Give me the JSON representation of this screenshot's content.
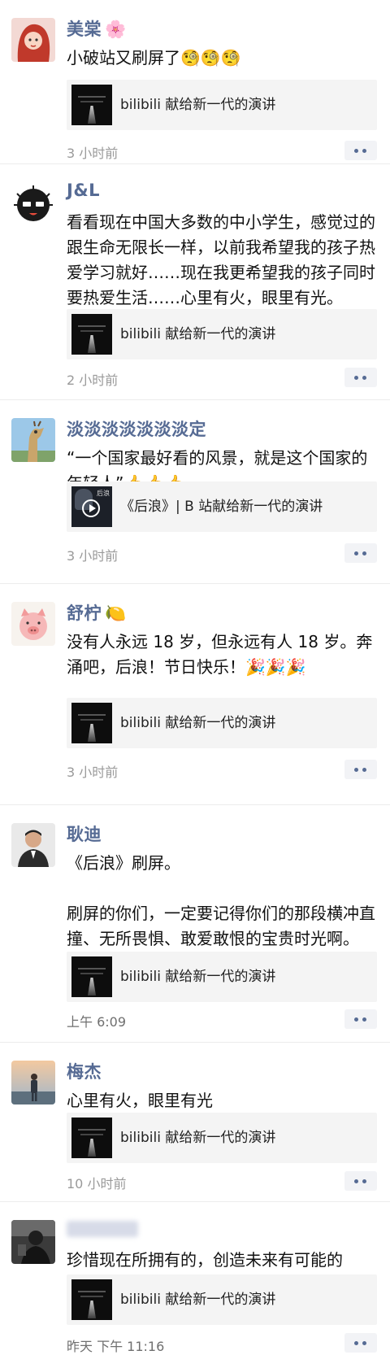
{
  "colors": {
    "name": "#566b94",
    "time": "#9a9a9a",
    "card_bg": "#f4f4f4"
  },
  "posts": [
    {
      "name": "美棠",
      "name_emoji": "🌸",
      "text": "小破站又刷屏了🧐🧐🧐",
      "link_title": "bilibili 献给新一代的演讲",
      "time": "3 小时前"
    },
    {
      "name": "J&L",
      "name_emoji": "",
      "text": "看看现在中国大多数的中小学生，感觉过的跟生命无限长一样，以前我希望我的孩子热爱学习就好……现在我更希望我的孩子同时要热爱生活……心里有火，眼里有光。",
      "link_title": "bilibili 献给新一代的演讲",
      "time": "2 小时前"
    },
    {
      "name": "淡淡淡淡淡淡淡定",
      "name_emoji": "",
      "text": "“一个国家最好看的风景，就是这个国家的年轻人”👍👍👍",
      "link_title": "《后浪》| B 站献给新一代的演讲",
      "time": "3 小时前"
    },
    {
      "name": "舒柠",
      "name_emoji": "🍋",
      "text": "没有人永远 18 岁，但永远有人 18 岁。奔涌吧，后浪！节日快乐！🎉🎉🎉",
      "link_title": "bilibili 献给新一代的演讲",
      "time": "3 小时前"
    },
    {
      "name": "耿迪",
      "name_emoji": "",
      "text": "《后浪》刷屏。\n\n刷屏的你们，一定要记得你们的那段横冲直撞、无所畏惧、敢爱敢恨的宝贵时光啊。",
      "link_title": "bilibili 献给新一代的演讲",
      "time": "上午 6:09"
    },
    {
      "name": "梅杰",
      "name_emoji": "",
      "text": "心里有火，眼里有光",
      "link_title": "bilibili 献给新一代的演讲",
      "time": "10 小时前"
    },
    {
      "name": "",
      "name_emoji": "",
      "text": "珍惜现在所拥有的，创造未来有可能的",
      "link_title": "bilibili 献给新一代的演讲",
      "time": "昨天  下午 11:16"
    }
  ]
}
